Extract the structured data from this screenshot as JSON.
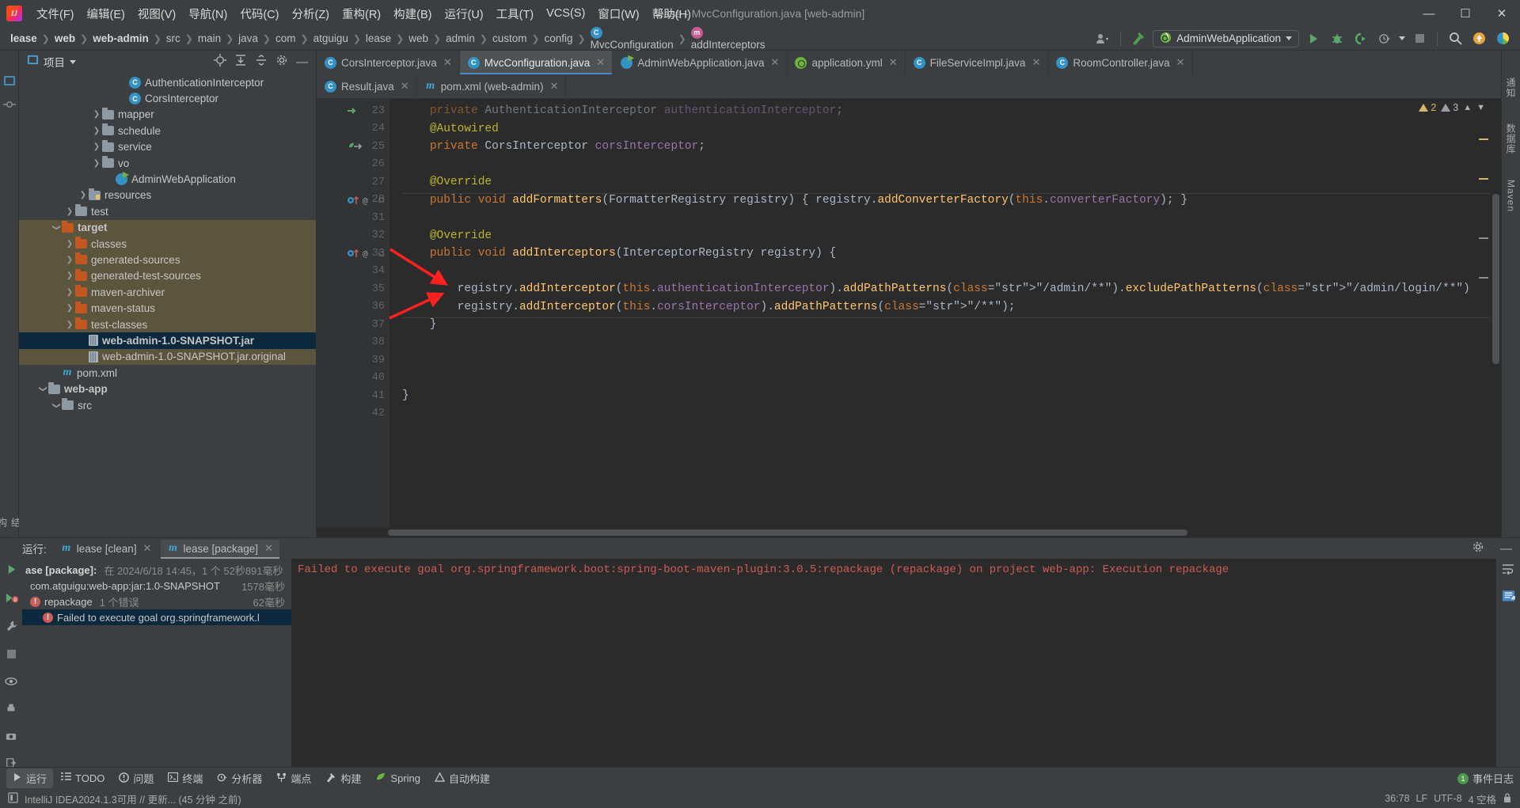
{
  "window": {
    "title": "lease - MvcConfiguration.java [web-admin]",
    "controls": [
      "minimize",
      "maximize",
      "close"
    ]
  },
  "menubar": {
    "items": [
      {
        "label": "文件(F)"
      },
      {
        "label": "编辑(E)"
      },
      {
        "label": "视图(V)"
      },
      {
        "label": "导航(N)"
      },
      {
        "label": "代码(C)"
      },
      {
        "label": "分析(Z)"
      },
      {
        "label": "重构(R)"
      },
      {
        "label": "构建(B)"
      },
      {
        "label": "运行(U)"
      },
      {
        "label": "工具(T)"
      },
      {
        "label": "VCS(S)"
      },
      {
        "label": "窗口(W)"
      },
      {
        "label": "帮助(H)"
      }
    ]
  },
  "navbar": {
    "breadcrumbs": [
      {
        "label": "lease",
        "bold": true
      },
      {
        "label": "web",
        "bold": true
      },
      {
        "label": "web-admin",
        "bold": true
      },
      {
        "label": "src",
        "bold": false
      },
      {
        "label": "main",
        "bold": false
      },
      {
        "label": "java",
        "bold": false
      },
      {
        "label": "com",
        "bold": false
      },
      {
        "label": "atguigu",
        "bold": false
      },
      {
        "label": "lease",
        "bold": false
      },
      {
        "label": "web",
        "bold": false
      },
      {
        "label": "admin",
        "bold": false
      },
      {
        "label": "custom",
        "bold": false
      },
      {
        "label": "config",
        "bold": false
      },
      {
        "label": "MvcConfiguration",
        "bold": false,
        "icon": "class-icon"
      },
      {
        "label": "addInterceptors",
        "bold": false,
        "icon": "method-icon"
      }
    ],
    "run_configuration": "AdminWebApplication",
    "toolbar_icons": [
      "user-avatar-icon",
      "build-hammer-icon",
      "run-icon",
      "debug-icon",
      "run-with-coverage-icon",
      "profiler-icon",
      "stop-icon",
      "search-everywhere-icon",
      "updates-icon",
      "ai-assistant-icon"
    ]
  },
  "project_panel": {
    "title": "项目",
    "tools": [
      "select-opened-file-icon",
      "expand-all-icon",
      "collapse-all-icon",
      "settings-icon",
      "hide-icon"
    ],
    "tree": [
      {
        "label": "AuthenticationInterceptor",
        "icon": "class-icon",
        "indent": 7,
        "arrow": "none"
      },
      {
        "label": "CorsInterceptor",
        "icon": "class-icon",
        "indent": 7,
        "arrow": "none"
      },
      {
        "label": "mapper",
        "icon": "folder-grey",
        "indent": 5,
        "arrow": "right"
      },
      {
        "label": "schedule",
        "icon": "folder-grey",
        "indent": 5,
        "arrow": "right"
      },
      {
        "label": "service",
        "icon": "folder-grey",
        "indent": 5,
        "arrow": "right"
      },
      {
        "label": "vo",
        "icon": "folder-grey",
        "indent": 5,
        "arrow": "right"
      },
      {
        "label": "AdminWebApplication",
        "icon": "spring-class-icon",
        "indent": 6,
        "arrow": "none"
      },
      {
        "label": "resources",
        "icon": "folder-resources",
        "indent": 4,
        "arrow": "right"
      },
      {
        "label": "test",
        "icon": "folder-grey",
        "indent": 3,
        "arrow": "right"
      },
      {
        "label": "target",
        "icon": "folder-orange",
        "indent": 2,
        "arrow": "down",
        "highlight": "tan",
        "bold": true
      },
      {
        "label": "classes",
        "icon": "folder-orange",
        "indent": 3,
        "arrow": "right",
        "highlight": "tan"
      },
      {
        "label": "generated-sources",
        "icon": "folder-orange",
        "indent": 3,
        "arrow": "right",
        "highlight": "tan"
      },
      {
        "label": "generated-test-sources",
        "icon": "folder-orange",
        "indent": 3,
        "arrow": "right",
        "highlight": "tan"
      },
      {
        "label": "maven-archiver",
        "icon": "folder-orange",
        "indent": 3,
        "arrow": "right",
        "highlight": "tan"
      },
      {
        "label": "maven-status",
        "icon": "folder-orange",
        "indent": 3,
        "arrow": "right",
        "highlight": "tan"
      },
      {
        "label": "test-classes",
        "icon": "folder-orange",
        "indent": 3,
        "arrow": "right",
        "highlight": "tan"
      },
      {
        "label": "web-admin-1.0-SNAPSHOT.jar",
        "icon": "jar-icon",
        "indent": 4,
        "arrow": "none",
        "highlight": "blue",
        "bold": true
      },
      {
        "label": "web-admin-1.0-SNAPSHOT.jar.original",
        "icon": "jar-icon",
        "indent": 4,
        "arrow": "none",
        "highlight": "tan"
      },
      {
        "label": "pom.xml",
        "icon": "maven-icon",
        "indent": 2,
        "arrow": "none"
      },
      {
        "label": "web-app",
        "icon": "folder-grey",
        "indent": 1,
        "arrow": "down",
        "bold": true
      },
      {
        "label": "src",
        "icon": "folder-grey",
        "indent": 2,
        "arrow": "down"
      }
    ]
  },
  "editor": {
    "tabs_row1": [
      {
        "label": "CorsInterceptor.java",
        "icon": "class-icon",
        "active": false
      },
      {
        "label": "MvcConfiguration.java",
        "icon": "class-icon",
        "active": true
      },
      {
        "label": "AdminWebApplication.java",
        "icon": "spring-class-icon",
        "active": false
      },
      {
        "label": "application.yml",
        "icon": "spring-yml-icon",
        "active": false
      },
      {
        "label": "FileServiceImpl.java",
        "icon": "class-icon",
        "active": false
      },
      {
        "label": "RoomController.java",
        "icon": "class-icon",
        "active": false
      }
    ],
    "tabs_row2": [
      {
        "label": "Result.java",
        "icon": "class-icon",
        "active": false
      },
      {
        "label": "pom.xml (web-admin)",
        "icon": "maven-icon",
        "active": false
      }
    ],
    "inspection": {
      "warnings": "2",
      "weak_warnings": "3"
    },
    "lines": [
      {
        "no": "23",
        "text": "    private AuthenticationInterceptor authenticationInterceptor;",
        "faded": true,
        "gmark": "bean-override-icon"
      },
      {
        "no": "24",
        "text": "    @Autowired",
        "kind": "annotation"
      },
      {
        "no": "25",
        "text": "    private CorsInterceptor corsInterceptor;",
        "gmark": "bean-icon"
      },
      {
        "no": "26",
        "text": ""
      },
      {
        "no": "27",
        "text": "    @Override",
        "kind": "annotation"
      },
      {
        "no": "28",
        "text": "    public void addFormatters(FormatterRegistry registry) { registry.addConverterFactory(this.converterFactory); }",
        "gmark": "override-method-icon"
      },
      {
        "no": "31",
        "text": ""
      },
      {
        "no": "32",
        "text": "    @Override",
        "kind": "annotation"
      },
      {
        "no": "33",
        "text": "    public void addInterceptors(InterceptorRegistry registry) {",
        "gmark": "override-method-icon"
      },
      {
        "no": "34",
        "text": ""
      },
      {
        "no": "35",
        "text": "        registry.addInterceptor(this.authenticationInterceptor).addPathPatterns(\"/admin/**\").excludePathPatterns(\"/admin/login/**\")"
      },
      {
        "no": "36",
        "text": "        registry.addInterceptor(this.corsInterceptor).addPathPatterns(\"/**\");"
      },
      {
        "no": "37",
        "text": "    }"
      },
      {
        "no": "38",
        "text": ""
      },
      {
        "no": "39",
        "text": ""
      },
      {
        "no": "40",
        "text": ""
      },
      {
        "no": "41",
        "text": "}"
      },
      {
        "no": "42",
        "text": ""
      }
    ]
  },
  "run_panel": {
    "label": "运行:",
    "tabs": [
      {
        "label": "lease [clean]",
        "icon": "maven-icon",
        "active": false
      },
      {
        "label": "lease [package]",
        "icon": "maven-icon",
        "active": true
      }
    ],
    "header_icons": [
      "settings-icon",
      "hide-icon"
    ],
    "side_icons": [
      "run-icon",
      "rerun-icon",
      "wrench-icon",
      "stop-square-icon",
      "eye-icon",
      "print-icon",
      "camera-icon",
      "export-icon",
      "star-icon"
    ],
    "tree": [
      {
        "label": "ase [package]:",
        "suffix": "在 2024/6/18 14:45，1 个 52秒891毫秒",
        "bold": true
      },
      {
        "label": "com.atguigu:web-app:jar:1.0-SNAPSHOT",
        "time": "1578毫秒"
      },
      {
        "label": "repackage",
        "suffix": "1 个错误",
        "time": "62毫秒",
        "icon": "error-icon"
      },
      {
        "label": "Failed to execute goal org.springframework.l",
        "icon": "error-icon",
        "selected": true
      }
    ],
    "console_text": "Failed to execute goal org.springframework.boot:spring-boot-maven-plugin:3.0.5:repackage (repackage) on project web-app: Execution repackage",
    "console_icons": [
      "wrap-text-icon",
      "scroll-end-icon"
    ]
  },
  "bottom_bar": {
    "items": [
      {
        "label": "运行",
        "icon": "run-icon",
        "active": true
      },
      {
        "label": "TODO",
        "icon": "todo-icon",
        "active": false
      },
      {
        "label": "问题",
        "icon": "problems-icon",
        "active": false
      },
      {
        "label": "终端",
        "icon": "terminal-icon",
        "active": false
      },
      {
        "label": "分析器",
        "icon": "profiler-icon",
        "active": false
      },
      {
        "label": "端点",
        "icon": "endpoints-icon",
        "active": false
      },
      {
        "label": "构建",
        "icon": "build-icon",
        "active": false
      },
      {
        "label": "Spring",
        "icon": "spring-icon",
        "active": false
      },
      {
        "label": "自动构建",
        "icon": "autobuild-icon",
        "active": false
      }
    ],
    "event_log": {
      "count": "1",
      "label": "事件日志"
    }
  },
  "status_bar": {
    "message": "IntelliJ IDEA2024.1.3可用 // 更新... (45 分钟 之前)",
    "caret_position": "36:78",
    "icons": [
      "lf-icon",
      "encoding-icon",
      "lock-icon"
    ]
  },
  "left_strip": {
    "items": [
      "project-icon",
      "commit-icon",
      "structure-icon",
      "bookmarks-icon"
    ]
  },
  "right_strip": {
    "items": [
      "notifications-icon",
      "database-icon",
      "maven-icon",
      "gradle-icon"
    ]
  },
  "colors": {
    "accent": "#4a88c7",
    "error": "#cf5b56",
    "warning": "#d6b76a",
    "background": "#3c3f41",
    "editor_bg": "#2b2b2b",
    "selection_blue": "#0d293e",
    "selection_tan": "#5c553e",
    "annotation_arrow": "#ff2020"
  }
}
